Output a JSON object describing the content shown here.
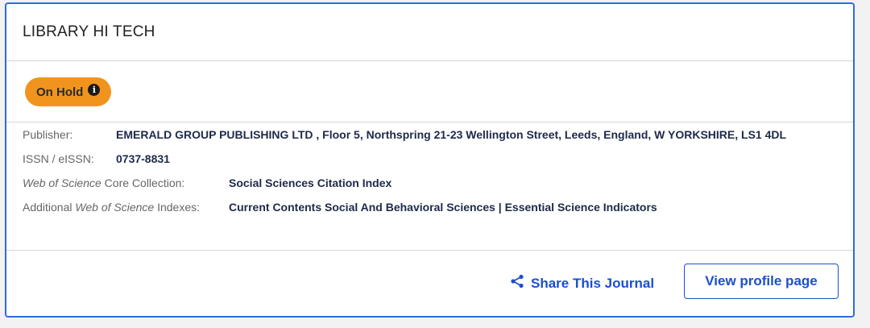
{
  "journal": {
    "title": "LIBRARY HI TECH",
    "status_badge": "On Hold",
    "status_icon": "info-icon"
  },
  "details": {
    "publisher_label": "Publisher:",
    "publisher_value": "EMERALD GROUP PUBLISHING LTD , Floor 5, Northspring 21-23 Wellington Street, Leeds, England, W YORKSHIRE, LS1 4DL",
    "issn_label": "ISSN / eISSN:",
    "issn_value": "0737-8831",
    "core_label_italic": "Web of Science",
    "core_label_rest": " Core Collection:",
    "core_value": "Social Sciences Citation Index",
    "additional_label_prefix": "Additional ",
    "additional_label_italic": "Web of Science",
    "additional_label_suffix": " Indexes:",
    "additional_value": "Current Contents Social And Behavioral Sciences | Essential Science Indicators"
  },
  "actions": {
    "share_label": "Share This Journal",
    "share_icon": "share-icon",
    "profile_label": "View profile page"
  },
  "colors": {
    "accent": "#1b4fcf",
    "card_border": "#2f6be0",
    "badge": "#f0941e"
  }
}
